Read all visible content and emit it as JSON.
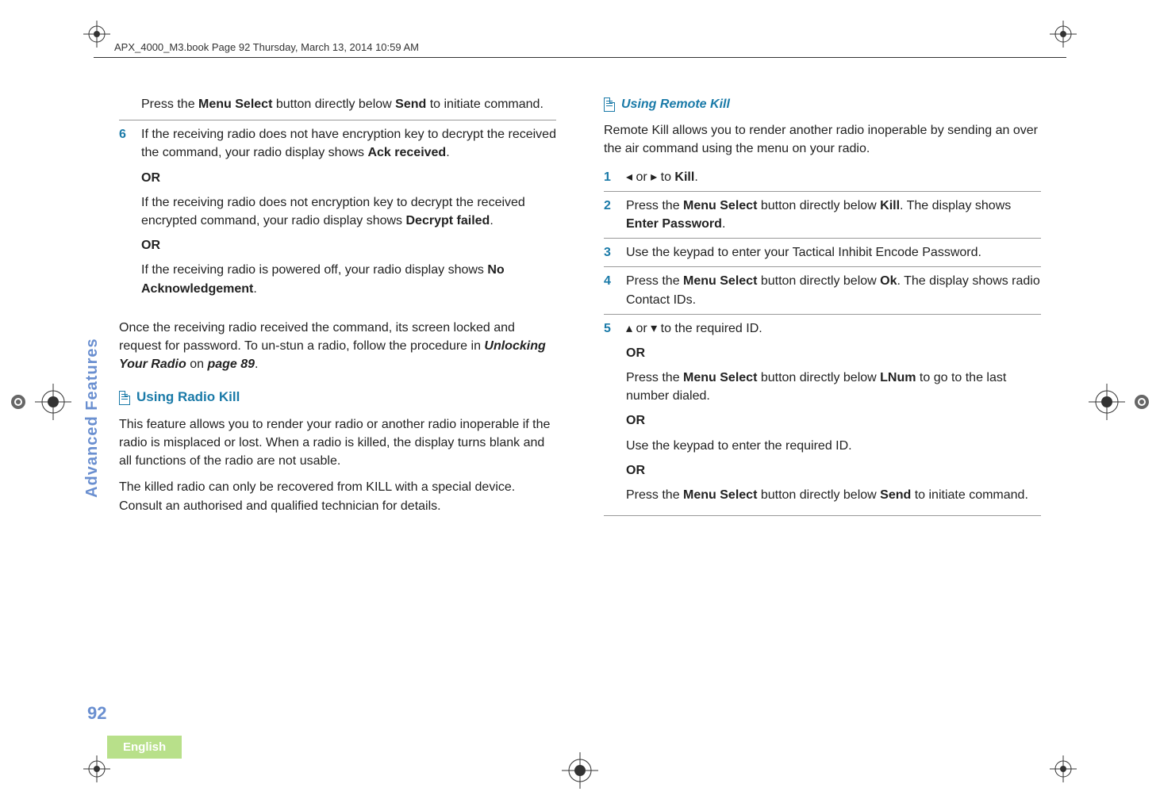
{
  "header": "APX_4000_M3.book  Page 92  Thursday, March 13, 2014  10:59 AM",
  "side_tab": "Advanced Features",
  "page_number": "92",
  "language": "English",
  "left": {
    "intro_cont": {
      "pre": "Press the ",
      "btn": "Menu Select",
      "mid": " button directly below ",
      "ui": "Send",
      "post": " to initiate command."
    },
    "step6": {
      "num": "6",
      "p1a": "If the receiving radio does not have encryption key to decrypt the received the command, your radio display shows ",
      "p1ui": "Ack received",
      "p1b": ".",
      "or1": "OR",
      "p2a": "If the receiving radio does not encryption key to decrypt the received encrypted command, your radio display shows ",
      "p2ui": "Decrypt failed",
      "p2b": ".",
      "or2": "OR",
      "p3a": "If the receiving radio is powered off, your radio display shows ",
      "p3ui": "No Acknowledgement",
      "p3b": "."
    },
    "after": {
      "a": "Once the receiving radio received the command, its screen locked and request for password. To un-stun a radio, follow the procedure in ",
      "b": "Unlocking Your Radio",
      "c": " on ",
      "d": "page 89",
      "e": "."
    },
    "h2": "Using Radio Kill",
    "para1": "This feature allows you to render your radio or another radio inoperable if the radio is misplaced or lost. When a radio is killed, the display turns blank and all functions of the radio are not usable.",
    "para2": "The killed radio can only be recovered from KILL with a special device. Consult an authorised and qualified technician for details."
  },
  "right": {
    "h3": "Using Remote Kill",
    "intro": "Remote Kill allows you to render another radio inoperable by sending an over the air command using the menu on your radio.",
    "s1": {
      "num": "1",
      "a": " or ",
      "b": " to ",
      "ui": "Kill",
      "c": "."
    },
    "s2": {
      "num": "2",
      "a": "Press the ",
      "btn": "Menu Select",
      "b": " button directly below ",
      "ui1": "Kill",
      "c": ". The display shows ",
      "ui2": "Enter Password",
      "d": "."
    },
    "s3": {
      "num": "3",
      "a": "Use the keypad to enter your Tactical Inhibit Encode Password."
    },
    "s4": {
      "num": "4",
      "a": "Press the ",
      "btn": "Menu Select",
      "b": " button directly below ",
      "ui": "Ok",
      "c": ". The display shows radio Contact IDs."
    },
    "s5": {
      "num": "5",
      "l1a": " or ",
      "l1b": " to the required ID.",
      "or1": "OR",
      "l2a": "Press the ",
      "l2btn": "Menu Select",
      "l2b": " button directly below ",
      "l2ui": "LNum",
      "l2c": " to go to the last number dialed.",
      "or2": "OR",
      "l3": "Use the keypad to enter the required ID.",
      "or3": "OR",
      "l4a": "Press the ",
      "l4btn": "Menu Select",
      "l4b": " button directly below ",
      "l4ui": "Send",
      "l4c": " to initiate command."
    }
  }
}
